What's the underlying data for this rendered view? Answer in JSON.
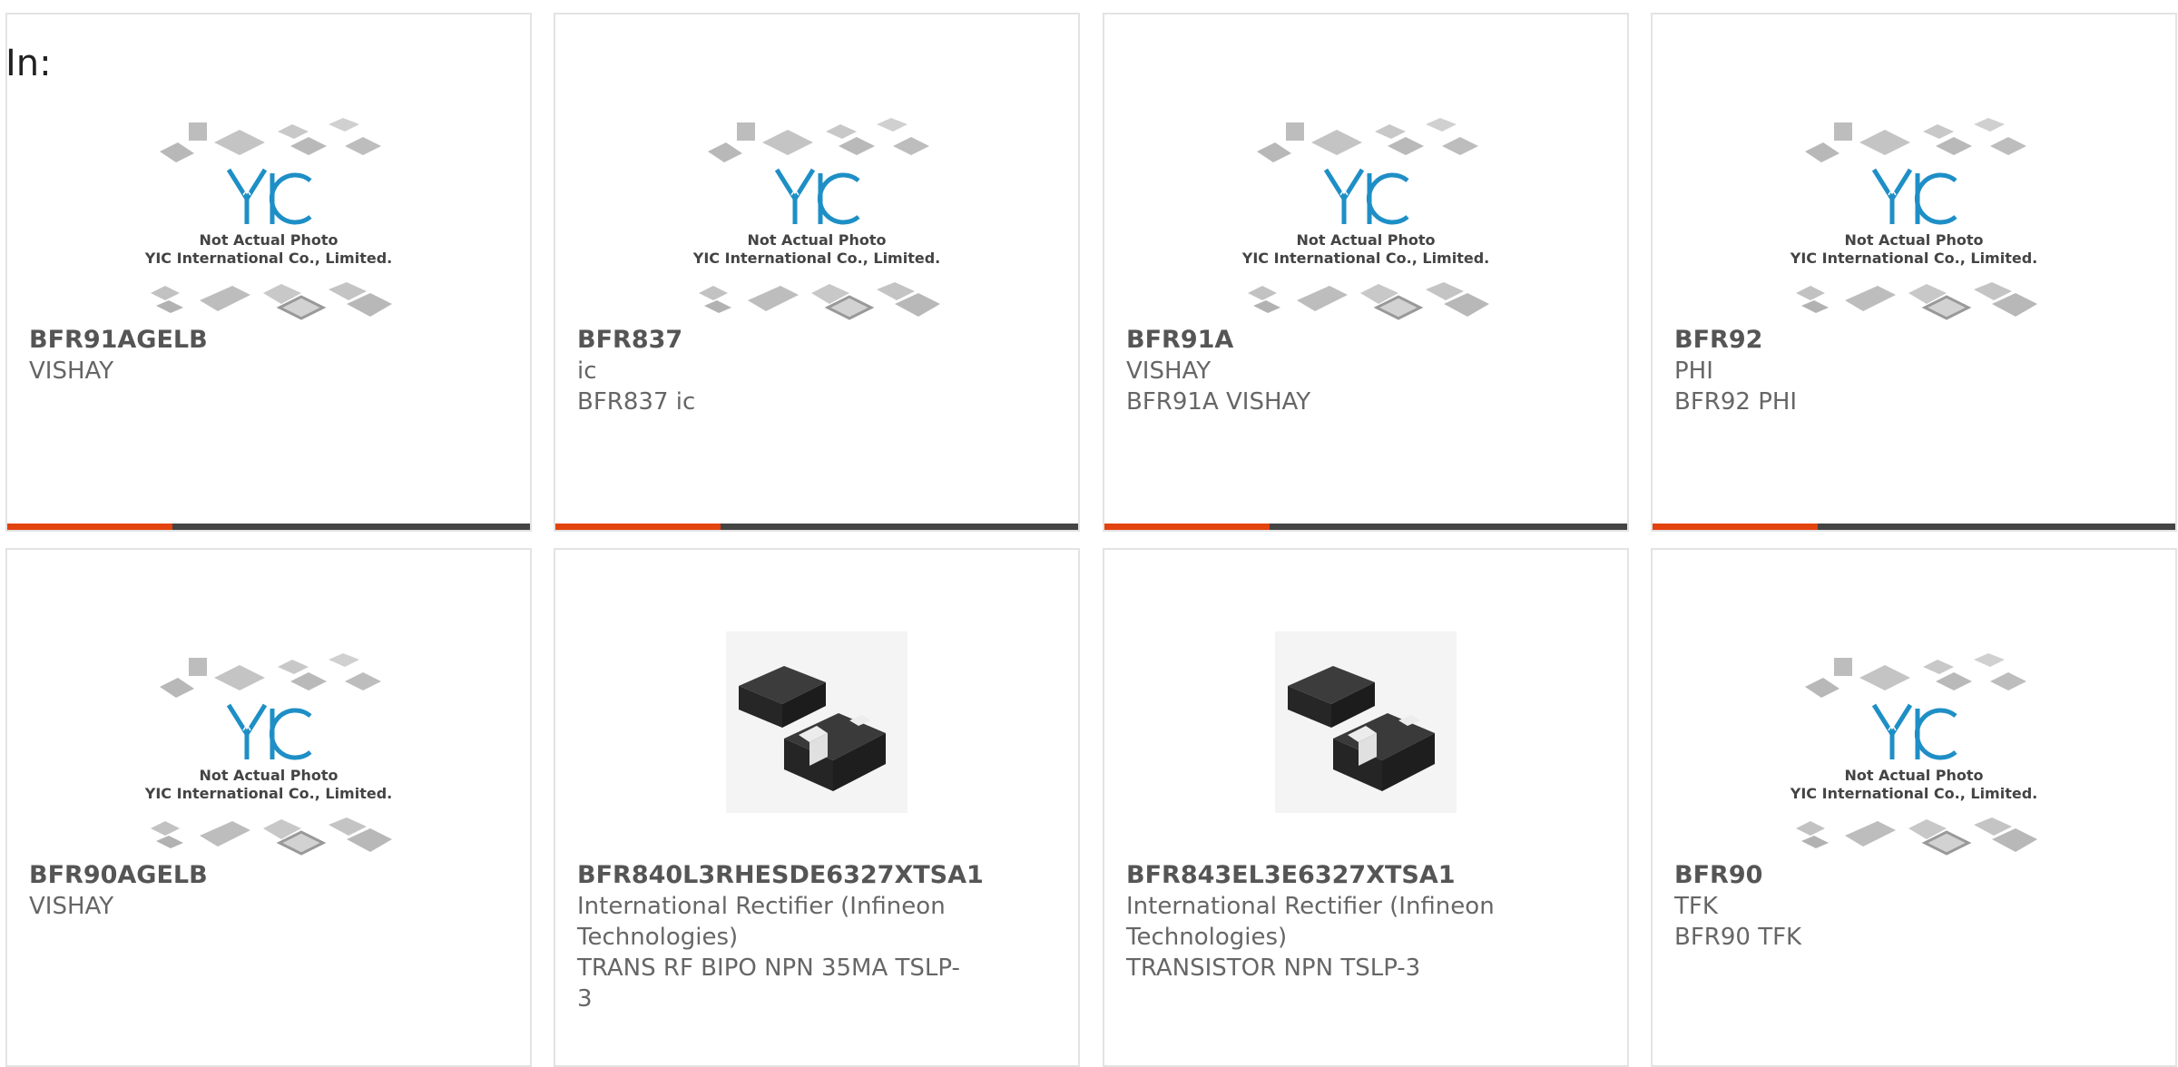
{
  "page": {
    "prefix_label": "In:"
  },
  "colors": {
    "accent": "#e2430f",
    "bar": "#444444",
    "border": "#e3e3e3",
    "logo": "#1e8fc6"
  },
  "placeholder_text": {
    "line1": "Not Actual Photo",
    "line2": "YIC International Co., Limited."
  },
  "products": [
    {
      "part": "BFR91AGELB",
      "lines": [
        "VISHAY"
      ],
      "image": "yic-placeholder",
      "show_bar": true
    },
    {
      "part": "BFR837",
      "lines": [
        "ic",
        "BFR837 ic"
      ],
      "image": "yic-placeholder",
      "show_bar": true
    },
    {
      "part": "BFR91A",
      "lines": [
        "VISHAY",
        "BFR91A VISHAY"
      ],
      "image": "yic-placeholder",
      "show_bar": true
    },
    {
      "part": "BFR92",
      "lines": [
        "PHI",
        "BFR92 PHI"
      ],
      "image": "yic-placeholder",
      "show_bar": true
    },
    {
      "part": "BFR90AGELB",
      "lines": [
        "VISHAY"
      ],
      "image": "yic-placeholder",
      "show_bar": false
    },
    {
      "part": "BFR840L3RHESDE6327XTSA1",
      "lines": [
        "International Rectifier (Infineon",
        "Technologies)",
        "TRANS RF BIPO NPN 35MA TSLP-",
        "3"
      ],
      "image": "tslp-package",
      "show_bar": false
    },
    {
      "part": "BFR843EL3E6327XTSA1",
      "lines": [
        "International Rectifier (Infineon",
        "Technologies)",
        "TRANSISTOR NPN TSLP-3"
      ],
      "image": "tslp-package",
      "show_bar": false
    },
    {
      "part": "BFR90",
      "lines": [
        "TFK",
        "BFR90 TFK"
      ],
      "image": "yic-placeholder",
      "show_bar": false
    }
  ]
}
